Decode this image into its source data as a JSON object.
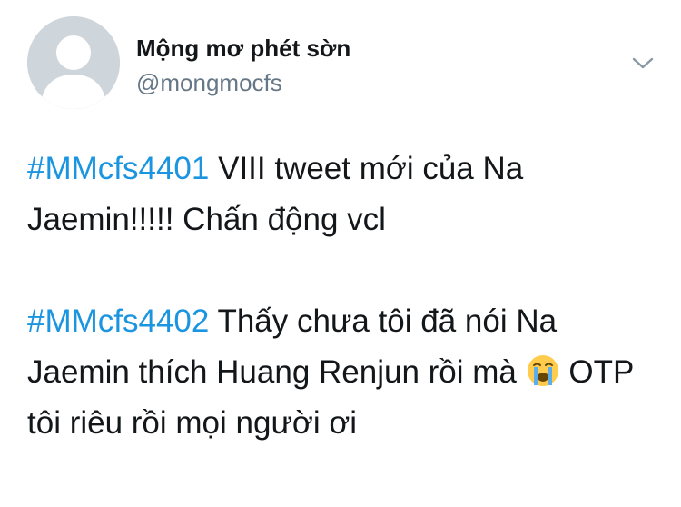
{
  "user": {
    "display_name": "Mộng mơ phét sờn",
    "handle": "@mongmocfs"
  },
  "icons": {
    "avatar": "default-profile-avatar",
    "more": "chevron-down-icon",
    "emoji": "loudly-crying-face-emoji"
  },
  "colors": {
    "hashtag": "#1b95e0",
    "text": "#14171a",
    "secondary": "#657786",
    "avatar_bg": "#cfd6db"
  },
  "tweet": {
    "p1": {
      "hashtag": "#MMcfs4401",
      "text": " VIII tweet mới của Na Jaemin!!!!! Chấn động vcl"
    },
    "p2": {
      "hashtag": "#MMcfs4402",
      "text_before_emoji": " Thấy chưa tôi đã nói Na Jaemin thích Huang Renjun rồi mà ",
      "text_after_emoji": " OTP tôi riêu rồi mọi người ơi"
    }
  }
}
